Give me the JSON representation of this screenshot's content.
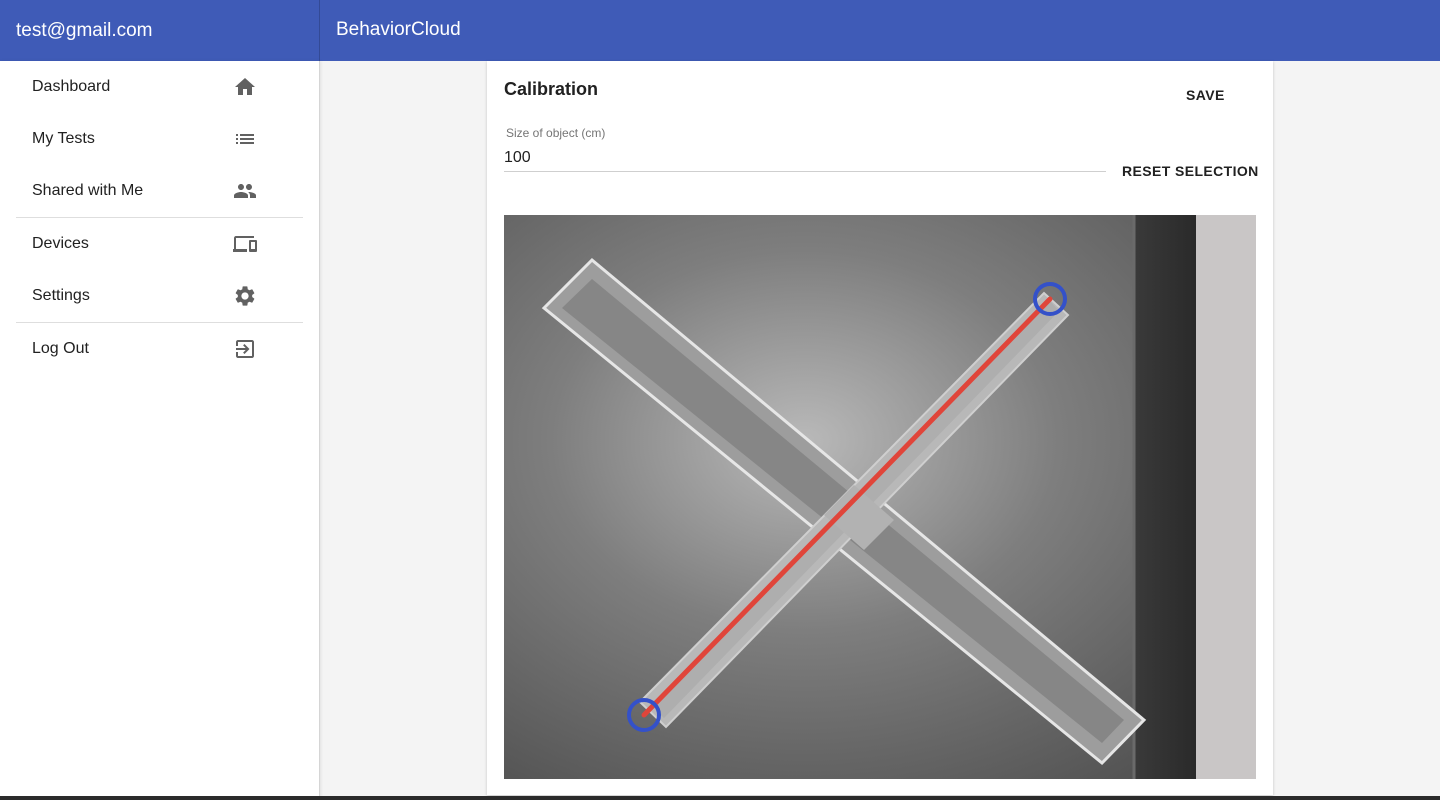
{
  "header": {
    "account_email": "test@gmail.com",
    "app_title": "BehaviorCloud"
  },
  "sidebar": {
    "groups": [
      [
        {
          "label": "Dashboard",
          "icon": "home-icon"
        },
        {
          "label": "My Tests",
          "icon": "list-icon"
        },
        {
          "label": "Shared with Me",
          "icon": "people-icon"
        }
      ],
      [
        {
          "label": "Devices",
          "icon": "devices-icon"
        },
        {
          "label": "Settings",
          "icon": "gear-icon"
        }
      ],
      [
        {
          "label": "Log Out",
          "icon": "logout-icon"
        }
      ]
    ]
  },
  "calibration": {
    "title": "Calibration",
    "save_label": "SAVE",
    "reset_label": "RESET SELECTION",
    "size_field": {
      "label": "Size of object (cm)",
      "value": "100"
    }
  },
  "colors": {
    "app_bar": "#3f5bb7",
    "selection_line": "#e0453a",
    "selection_handle": "#3451c9"
  }
}
